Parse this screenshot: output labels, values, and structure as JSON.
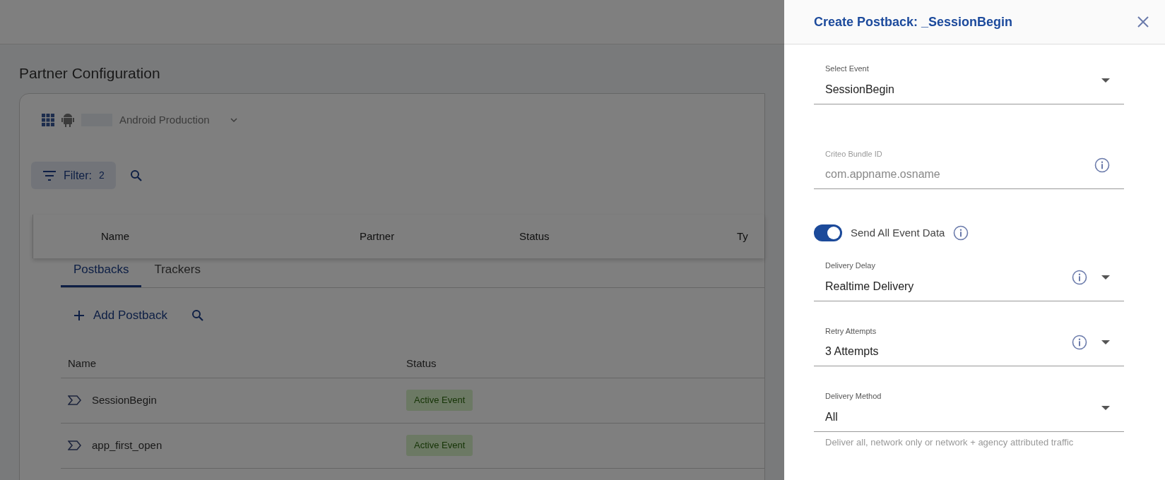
{
  "page": {
    "title": "Partner Configuration",
    "app": {
      "name": "Android Production"
    },
    "filter": {
      "label": "Filter:",
      "count": "2"
    },
    "main_table": {
      "columns": [
        "Name",
        "Partner",
        "Status",
        "Ty"
      ]
    },
    "tabs": [
      {
        "label": "Postbacks",
        "selected": true
      },
      {
        "label": "Trackers",
        "selected": false
      }
    ],
    "add_button": "Add Postback",
    "postbacks": {
      "columns": [
        "Name",
        "Status"
      ],
      "rows": [
        {
          "name": "SessionBegin",
          "status": "Active Event"
        },
        {
          "name": "app_first_open",
          "status": "Active Event"
        }
      ]
    }
  },
  "drawer": {
    "title": "Create Postback: _SessionBegin",
    "fields": [
      {
        "kind": "select",
        "label": "Select Event",
        "value": "SessionBegin",
        "info": false
      },
      {
        "kind": "text",
        "label": "Criteo Bundle ID",
        "placeholder": "com.appname.osname",
        "info": true
      },
      {
        "kind": "toggle",
        "label": "Send All Event Data",
        "on": true,
        "info": true
      },
      {
        "kind": "select",
        "label": "Delivery Delay",
        "value": "Realtime Delivery",
        "info": true
      },
      {
        "kind": "select",
        "label": "Retry Attempts",
        "value": "3 Attempts",
        "info": true
      },
      {
        "kind": "select",
        "label": "Delivery Method",
        "value": "All",
        "info": false,
        "helper": "Deliver all, network only or network + agency attributed traffic"
      }
    ]
  }
}
